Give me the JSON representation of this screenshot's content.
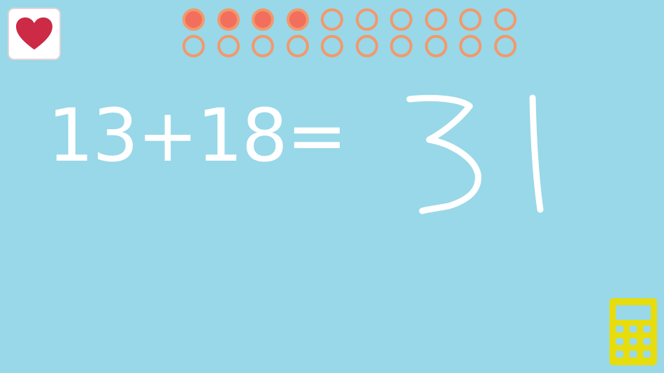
{
  "game": {
    "problem": "13+18=",
    "handwritten_answer": "31",
    "progress": {
      "total": 20,
      "completed": 4
    }
  },
  "icons": {
    "lives": "heart-icon",
    "calculator": "calculator-icon"
  },
  "colors": {
    "background": "#98d8e8",
    "progress_filled": "#f26f5d",
    "progress_ring": "#f4986a",
    "heart": "#cc2a45",
    "calculator": "#e8dd0c",
    "text": "#ffffff"
  }
}
